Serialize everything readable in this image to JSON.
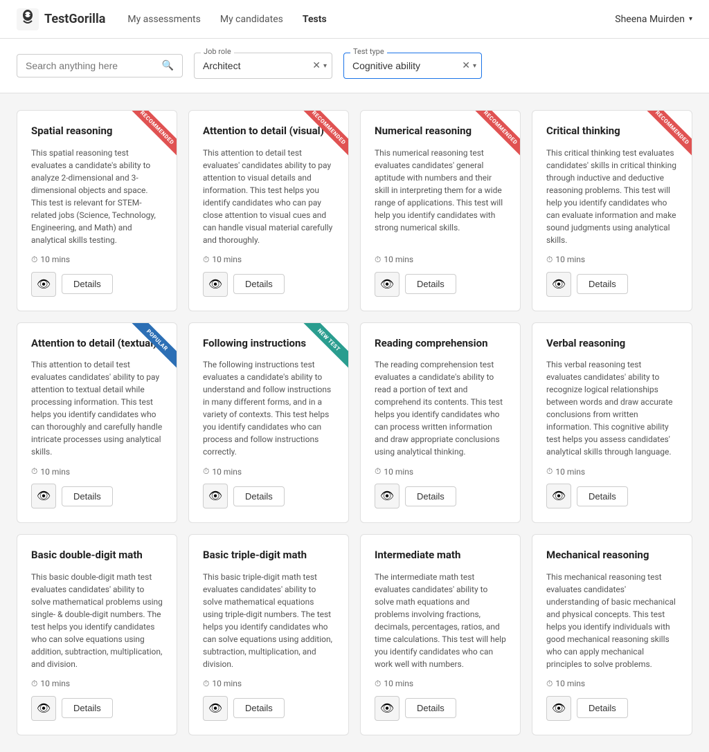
{
  "brand": {
    "name": "TestGorilla"
  },
  "nav": {
    "links": [
      {
        "label": "My assessments",
        "active": false
      },
      {
        "label": "My candidates",
        "active": false
      },
      {
        "label": "Tests",
        "active": true
      }
    ],
    "user": "Sheena Muirden"
  },
  "filters": {
    "search_placeholder": "Search anything here",
    "job_role_label": "Job role",
    "job_role_value": "Architect",
    "test_type_label": "Test type",
    "test_type_value": "Cognitive ability"
  },
  "cards": [
    {
      "title": "Spatial reasoning",
      "desc": "This spatial reasoning test evaluates a candidate's ability to analyze 2-dimensional and 3-dimensional objects and space. This test is relevant for STEM-related jobs (Science, Technology, Engineering, and Math) and analytical skills testing.",
      "duration": "10 mins",
      "ribbon": "RECOMMENDED",
      "ribbon_color": "red",
      "details_label": "Details"
    },
    {
      "title": "Attention to detail (visual)",
      "desc": "This attention to detail test evaluates' candidates ability to pay attention to visual details and information. This test helps you identify candidates who can pay close attention to visual cues and can handle visual material carefully and thoroughly.",
      "duration": "10 mins",
      "ribbon": "RECOMMENDED",
      "ribbon_color": "red",
      "details_label": "Details"
    },
    {
      "title": "Numerical reasoning",
      "desc": "This numerical reasoning test evaluates candidates' general aptitude with numbers and their skill in interpreting them for a wide range of applications. This test will help you identify candidates with strong numerical skills.",
      "duration": "10 mins",
      "ribbon": "RECOMMENDED",
      "ribbon_color": "red",
      "details_label": "Details"
    },
    {
      "title": "Critical thinking",
      "desc": "This critical thinking test evaluates candidates' skills in critical thinking through inductive and deductive reasoning problems. This test will help you identify candidates who can evaluate information and make sound judgments using analytical skills.",
      "duration": "10 mins",
      "ribbon": "RECOMMENDED",
      "ribbon_color": "red",
      "details_label": "Details"
    },
    {
      "title": "Attention to detail (textual)",
      "desc": "This attention to detail test evaluates candidates' ability to pay attention to textual detail while processing information. This test helps you identify candidates who can thoroughly and carefully handle intricate processes using analytical skills.",
      "duration": "10 mins",
      "ribbon": "POPULAR",
      "ribbon_color": "blue",
      "details_label": "Details"
    },
    {
      "title": "Following instructions",
      "desc": "The following instructions test evaluates a candidate's ability to understand and follow instructions in many different forms, and in a variety of contexts. This test helps you identify candidates who can process and follow instructions correctly.",
      "duration": "10 mins",
      "ribbon": "NEW TEST",
      "ribbon_color": "green",
      "details_label": "Details"
    },
    {
      "title": "Reading comprehension",
      "desc": "The reading comprehension test evaluates a candidate's ability to read a portion of text and comprehend its contents. This test helps you identify candidates who can process written information and draw appropriate conclusions using analytical thinking.",
      "duration": "10 mins",
      "ribbon": null,
      "ribbon_color": null,
      "details_label": "Details"
    },
    {
      "title": "Verbal reasoning",
      "desc": "This verbal reasoning test evaluates candidates' ability to recognize logical relationships between words and draw accurate conclusions from written information. This cognitive ability test helps you assess candidates' analytical skills through language.",
      "duration": "10 mins",
      "ribbon": null,
      "ribbon_color": null,
      "details_label": "Details"
    },
    {
      "title": "Basic double-digit math",
      "desc": "This basic double-digit math test evaluates candidates' ability to solve mathematical problems using single- & double-digit numbers. The test helps you identify candidates who can solve equations using addition, subtraction, multiplication, and division.",
      "duration": "10 mins",
      "ribbon": null,
      "ribbon_color": null,
      "details_label": "Details"
    },
    {
      "title": "Basic triple-digit math",
      "desc": "This basic triple-digit math test evaluates candidates' ability to solve mathematical equations using triple-digit numbers. The test helps you identify candidates who can solve equations using addition, subtraction, multiplication, and division.",
      "duration": "10 mins",
      "ribbon": null,
      "ribbon_color": null,
      "details_label": "Details"
    },
    {
      "title": "Intermediate math",
      "desc": "The intermediate math test evaluates candidates' ability to solve math equations and problems involving fractions, decimals, percentages, ratios, and time calculations. This test will help you identify candidates who can work well with numbers.",
      "duration": "10 mins",
      "ribbon": null,
      "ribbon_color": null,
      "details_label": "Details"
    },
    {
      "title": "Mechanical reasoning",
      "desc": "This mechanical reasoning test evaluates candidates' understanding of basic mechanical and physical concepts. This test helps you identify individuals with good mechanical reasoning skills who can apply mechanical principles to solve problems.",
      "duration": "10 mins",
      "ribbon": null,
      "ribbon_color": null,
      "details_label": "Details"
    }
  ]
}
